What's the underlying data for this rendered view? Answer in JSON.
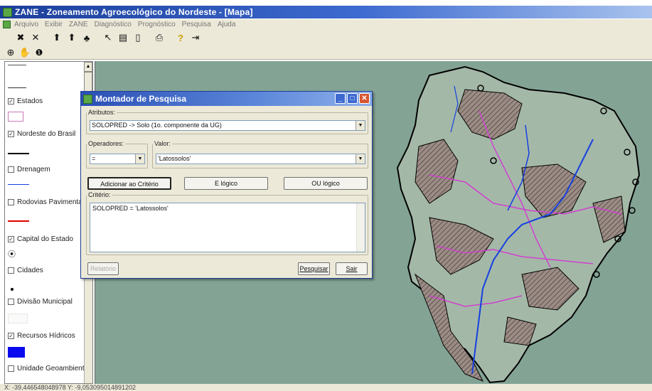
{
  "window": {
    "title": "ZANE - Zoneamento Agroecológico do Nordeste - [Mapa]"
  },
  "menu": [
    "Arquivo",
    "Exibir",
    "ZANE",
    "Diagnóstico",
    "Prognóstico",
    "Pesquisa",
    "Ajuda"
  ],
  "toolbar1": [
    {
      "icon": "zoom-extent-icon",
      "glyph": "✖"
    },
    {
      "icon": "zoom-full-icon",
      "glyph": "✕"
    },
    {
      "icon": "add-layer-icon",
      "glyph": "⬆"
    },
    {
      "icon": "remove-layer-icon",
      "glyph": "⬆"
    },
    {
      "icon": "layer-properties-icon",
      "glyph": "♣"
    },
    {
      "icon": "pointer-icon",
      "glyph": "↖"
    },
    {
      "icon": "table-icon",
      "glyph": "▤"
    },
    {
      "icon": "layout-icon",
      "glyph": "▯"
    },
    {
      "icon": "print-icon",
      "glyph": "⎙"
    },
    {
      "icon": "help-icon",
      "glyph": "?"
    },
    {
      "icon": "exit-icon",
      "glyph": "⇥"
    }
  ],
  "toolbar2": [
    {
      "icon": "zoom-in-icon",
      "glyph": "⊕"
    },
    {
      "icon": "pan-hand-icon",
      "glyph": "✋"
    },
    {
      "icon": "info-icon",
      "glyph": "❶"
    }
  ],
  "legend": {
    "items": [
      {
        "label": "Estados",
        "checked": true
      },
      {
        "label": "Nordeste do Brasil",
        "checked": true
      },
      {
        "label": "Drenagem",
        "checked": false
      },
      {
        "label": "Rodovias Pavimentad",
        "checked": false
      },
      {
        "label": "Capital do Estado",
        "checked": true
      },
      {
        "label": "Cidades",
        "checked": false
      },
      {
        "label": "Divisão Municipal",
        "checked": false
      },
      {
        "label": "Recursos Hídricos",
        "checked": true
      },
      {
        "label": "Unidade Geoambient",
        "checked": false
      }
    ]
  },
  "dialog": {
    "title": "Montador de Pesquisa",
    "atributos_label": "Atributos:",
    "atributos_value": "SOLOPRED  ->   Solo (1o. componente da UG)",
    "operadores_label": "Operadores:",
    "operadores_value": "=",
    "valor_label": "Valor:",
    "valor_value": "'Latossolos'",
    "btn_adicionar": "Adicionar ao Critério",
    "btn_e": "E lógico",
    "btn_ou": "OU lógico",
    "criterio_label": "Critério:",
    "criterio_value": "SOLOPRED  = 'Latossolos'",
    "btn_relatorio": "Relatório",
    "btn_pesquisar": "Pesquisar",
    "btn_sair": "Sair"
  },
  "status": {
    "text": "X: -39,446548048978  Y: -9,053095014891202"
  },
  "colors": {
    "map_bg": "#83a395",
    "land": "#a4b8a8",
    "hatch": "#5b4a45",
    "rivers": "#1540e0",
    "roads": "#d040d0"
  }
}
